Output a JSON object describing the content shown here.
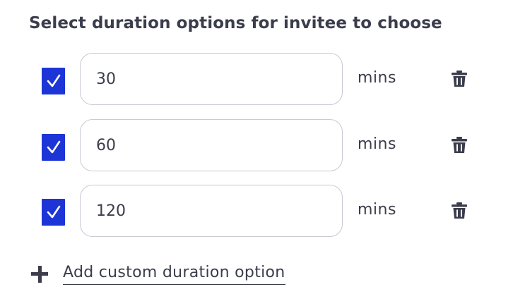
{
  "heading": "Select duration options for invitee to choose",
  "options": [
    {
      "checked": true,
      "value": "30",
      "unit": "mins"
    },
    {
      "checked": true,
      "value": "60",
      "unit": "mins"
    },
    {
      "checked": true,
      "value": "120",
      "unit": "mins"
    }
  ],
  "add_option_label": "Add custom duration option",
  "icons": {
    "checkbox": "check-icon",
    "delete": "trash-icon",
    "add": "plus-icon"
  },
  "colors": {
    "checkbox_fill": "#1d35d6",
    "text": "#3b3d4c",
    "field_border": "#c9cad2"
  }
}
